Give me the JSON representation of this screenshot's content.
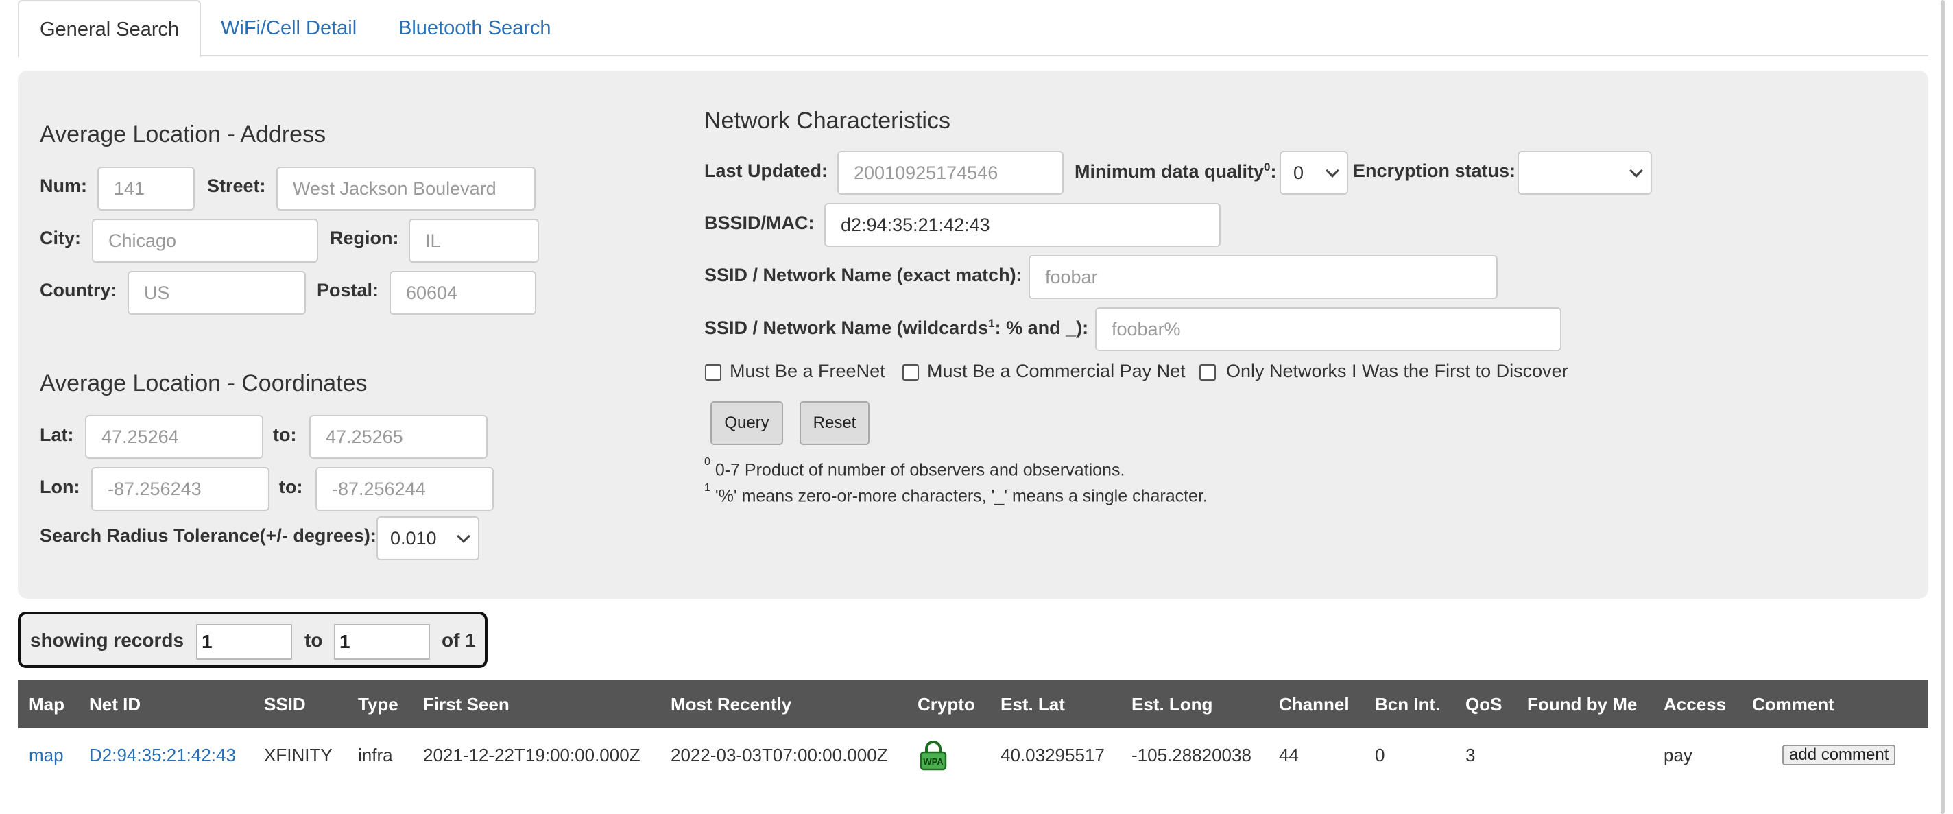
{
  "tabs": [
    "General Search",
    "WiFi/Cell Detail",
    "Bluetooth Search"
  ],
  "address": {
    "heading": "Average Location - Address",
    "num_label": "Num:",
    "num_ph": "141",
    "street_label": "Street:",
    "street_ph": "West Jackson Boulevard",
    "city_label": "City:",
    "city_ph": "Chicago",
    "region_label": "Region:",
    "region_ph": "IL",
    "country_label": "Country:",
    "country_ph": "US",
    "postal_label": "Postal:",
    "postal_ph": "60604"
  },
  "coords": {
    "heading": "Average Location - Coordinates",
    "lat_label": "Lat:",
    "lat_from_ph": "47.25264",
    "to_label": "to:",
    "lat_to_ph": "47.25265",
    "lon_label": "Lon:",
    "lon_from_ph": "-87.256243",
    "lon_to_ph": "-87.256244",
    "radius_label": "Search Radius Tolerance(+/- degrees):",
    "radius_value": "0.010"
  },
  "network": {
    "heading": "Network Characteristics",
    "last_updated_label": "Last Updated:",
    "last_updated_ph": "20010925174546",
    "min_quality_label": "Minimum data quality",
    "min_quality_sup": "0",
    "min_quality_colon": ":",
    "min_quality_value": "0",
    "encryption_label": "Encryption status:",
    "encryption_value": "",
    "bssid_label": "BSSID/MAC:",
    "bssid_value": "d2:94:35:21:42:43",
    "ssid_exact_label": "SSID / Network Name (exact match):",
    "ssid_exact_ph": "foobar",
    "ssid_wild_label_a": "SSID / Network Name (wildcards",
    "ssid_wild_sup": "1",
    "ssid_wild_label_b": ": % and _):",
    "ssid_wild_ph": "foobar%",
    "freenet_label": "Must Be a FreeNet",
    "paynet_label": "Must Be a Commercial Pay Net",
    "first_label": "Only Networks I Was the First to Discover",
    "query_label": "Query",
    "reset_label": "Reset",
    "note0_sup": "0",
    "note0": " 0-7 Product of number of observers and observations.",
    "note1_sup": "1",
    "note1": " '%' means zero-or-more characters, '_' means a single character."
  },
  "records": {
    "showing": "showing records",
    "from": "1",
    "to_label": "to",
    "to": "1",
    "of": "of 1"
  },
  "table": {
    "headers": [
      "Map",
      "Net ID",
      "SSID",
      "Type",
      "First Seen",
      "Most Recently",
      "Crypto",
      "Est. Lat",
      "Est. Long",
      "Channel",
      "Bcn Int.",
      "QoS",
      "Found by Me",
      "Access",
      "Comment"
    ],
    "rows": [
      {
        "map": "map",
        "net_id": "D2:94:35:21:42:43",
        "ssid": "XFINITY",
        "type": "infra",
        "first_seen": "2021-12-22T19:00:00.000Z",
        "most_recently": "2022-03-03T07:00:00.000Z",
        "crypto": "WPA",
        "crypto_icon": "lock-icon",
        "crypto_color": "#2e8b2e",
        "est_lat": "40.03295517",
        "est_long": "-105.28820038",
        "channel": "44",
        "bcn_int": "0",
        "qos": "3",
        "found_by_me": "",
        "access": "pay",
        "comment_button": "add comment"
      }
    ]
  }
}
